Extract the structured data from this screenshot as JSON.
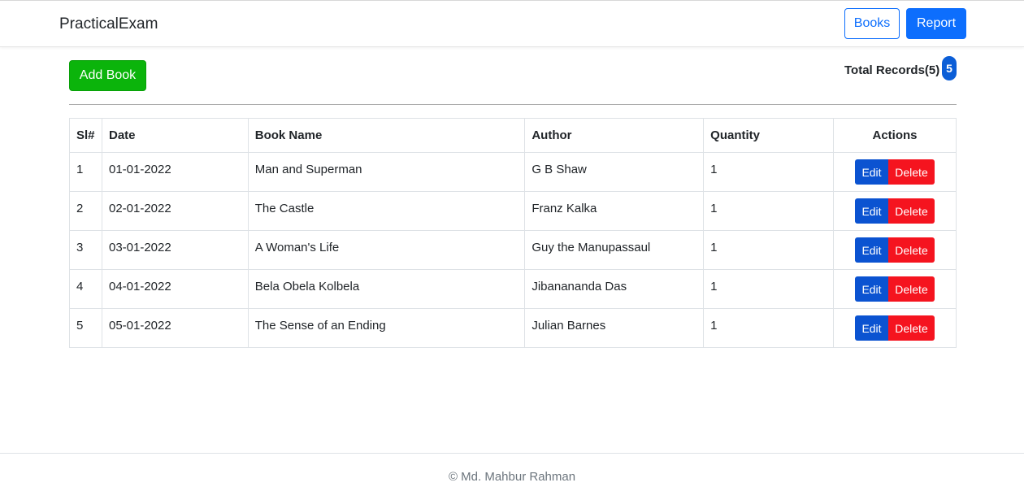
{
  "navbar": {
    "brand": "PracticalExam",
    "books_label": "Books",
    "report_label": "Report"
  },
  "toolbar": {
    "add_book_label": "Add Book",
    "total_records_label": "Total Records(5)",
    "total_badge": "5"
  },
  "table": {
    "headers": {
      "sl": "Sl#",
      "date": "Date",
      "book_name": "Book Name",
      "author": "Author",
      "quantity": "Quantity",
      "actions": "Actions"
    },
    "rows": [
      {
        "sl": "1",
        "date": "01-01-2022",
        "book_name": "Man and Superman",
        "author": "G B Shaw",
        "quantity": "1"
      },
      {
        "sl": "2",
        "date": "02-01-2022",
        "book_name": "The Castle",
        "author": "Franz Kalka",
        "quantity": "1"
      },
      {
        "sl": "3",
        "date": "03-01-2022",
        "book_name": "A Woman's Life",
        "author": "Guy the Manupassaul",
        "quantity": "1"
      },
      {
        "sl": "4",
        "date": "04-01-2022",
        "book_name": "Bela Obela Kolbela",
        "author": "Jibanananda Das",
        "quantity": "1"
      },
      {
        "sl": "5",
        "date": "05-01-2022",
        "book_name": "The Sense of an Ending",
        "author": "Julian Barnes",
        "quantity": "1"
      }
    ],
    "edit_label": "Edit",
    "delete_label": "Delete"
  },
  "footer": {
    "text": "© Md. Mahbur Rahman"
  },
  "colors": {
    "primary": "#0d6efd",
    "success": "#0bb40b",
    "danger": "#f5141f",
    "edit": "#0b53d1"
  }
}
